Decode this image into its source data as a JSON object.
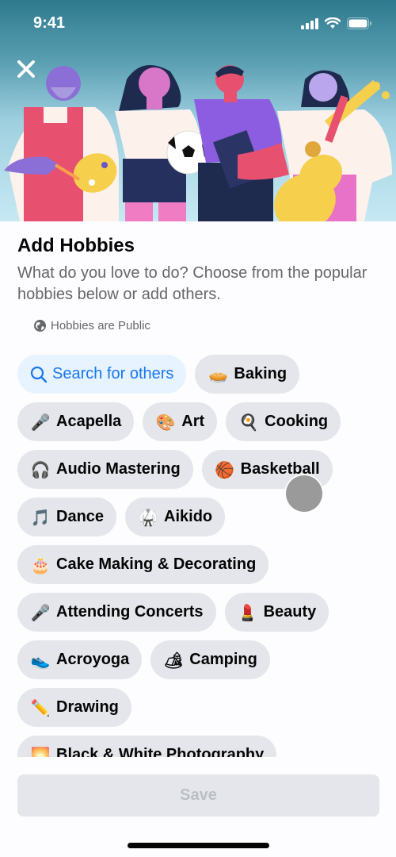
{
  "status_bar": {
    "time": "9:41",
    "icons": [
      "signal-icon",
      "wifi-icon",
      "battery-icon"
    ]
  },
  "header": {
    "close_icon": "close-icon",
    "illustration": "people-with-hobbies-illustration"
  },
  "page": {
    "title": "Add Hobbies",
    "subtitle": "What do you love to do? Choose from the popular hobbies below or add others.",
    "privacy_icon": "globe-icon",
    "privacy_label": "Hobbies are Public"
  },
  "search_chip": {
    "icon": "search-icon",
    "label": "Search for others"
  },
  "hobbies": [
    {
      "emoji": "🥧",
      "icon": "pie-icon",
      "label": "Baking"
    },
    {
      "emoji": "🎤",
      "icon": "microphone-icon",
      "label": "Acapella"
    },
    {
      "emoji": "🎨",
      "icon": "palette-icon",
      "label": "Art"
    },
    {
      "emoji": "🍳",
      "icon": "frying-pan-icon",
      "label": "Cooking"
    },
    {
      "emoji": "🎧",
      "icon": "headphones-icon",
      "label": "Audio Mastering"
    },
    {
      "emoji": "🏀",
      "icon": "basketball-icon",
      "label": "Basketball"
    },
    {
      "emoji": "🎵",
      "icon": "music-note-icon",
      "label": "Dance"
    },
    {
      "emoji": "🥋",
      "icon": "martial-arts-uniform-icon",
      "label": "Aikido"
    },
    {
      "emoji": "🎂",
      "icon": "cake-icon",
      "label": "Cake Making & Decorating"
    },
    {
      "emoji": "🎤",
      "icon": "microphone-icon",
      "label": "Attending Concerts"
    },
    {
      "emoji": "💄",
      "icon": "lipstick-icon",
      "label": "Beauty"
    },
    {
      "emoji": "👟",
      "icon": "sneaker-icon",
      "label": "Acroyoga"
    },
    {
      "emoji": "🏕",
      "icon": "camping-icon",
      "label": "Camping"
    },
    {
      "emoji": "✏️",
      "icon": "pencil-icon",
      "label": "Drawing"
    },
    {
      "emoji": "🌅",
      "icon": "sunrise-icon",
      "label": "Black & White Photography"
    }
  ],
  "footer": {
    "save_label": "Save"
  },
  "colors": {
    "accent": "#1877f2",
    "search_chip_bg": "#e7f3ff",
    "chip_bg": "#e4e6eb",
    "save_disabled_text": "#bcc0c4"
  }
}
